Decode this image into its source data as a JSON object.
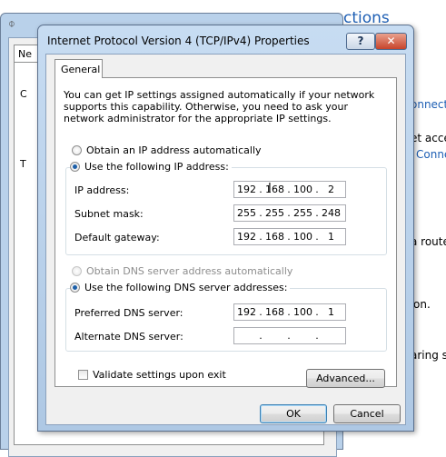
{
  "background": {
    "title_fragment": "ctions",
    "fragments": [
      {
        "text": "onnect",
        "link": true
      },
      {
        "text": "et acces",
        "link": false
      },
      {
        "text": "Conne",
        "link": true
      },
      {
        "text": "a route",
        "link": false
      },
      {
        "text": "on.",
        "link": false
      },
      {
        "text": "aring se",
        "link": false
      }
    ],
    "back_tab_label": "Ne",
    "back_tab_letter_1": "C",
    "back_tab_letter_2": "T"
  },
  "dialog": {
    "title": "Internet Protocol Version 4 (TCP/IPv4) Properties",
    "help_label": "?",
    "close_label": "✕",
    "tab_label": "General",
    "description": "You can get IP settings assigned automatically if your network supports this capability. Otherwise, you need to ask your network administrator for the appropriate IP settings.",
    "ip_auto_label": "Obtain an IP address automatically",
    "ip_manual_label": "Use the following IP address:",
    "fields": {
      "ip_label": "IP address:",
      "ip": [
        "192",
        "168",
        "100",
        "2"
      ],
      "subnet_label": "Subnet mask:",
      "subnet": [
        "255",
        "255",
        "255",
        "248"
      ],
      "gateway_label": "Default gateway:",
      "gateway": [
        "192",
        "168",
        "100",
        "1"
      ]
    },
    "dns_auto_label": "Obtain DNS server address automatically",
    "dns_manual_label": "Use the following DNS server addresses:",
    "dns": {
      "preferred_label": "Preferred DNS server:",
      "preferred": [
        "192",
        "168",
        "100",
        "1"
      ],
      "alternate_label": "Alternate DNS server:",
      "alternate": [
        "",
        "",
        "",
        ""
      ]
    },
    "validate_label": "Validate settings upon exit",
    "advanced_label": "Advanced...",
    "ok_label": "OK",
    "cancel_label": "Cancel"
  }
}
